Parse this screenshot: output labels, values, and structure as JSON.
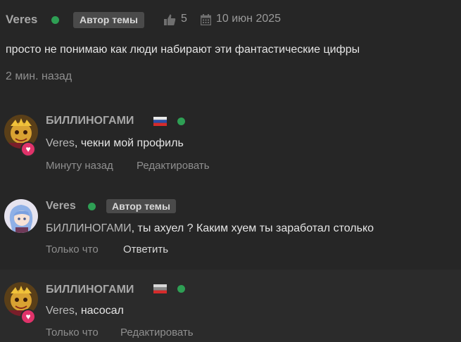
{
  "post": {
    "author": "Veres",
    "author_badge": "Автор темы",
    "likes": "5",
    "date": "10 июн 2025",
    "text": "просто не понимаю как люди набирают эти фантастические цифры",
    "time": "2 мин. назад"
  },
  "replies": [
    {
      "author": "БИЛЛИНОГАМИ",
      "mention": "Veres",
      "text": ", чекни мой профиль",
      "time": "Минуту назад",
      "action": "Редактировать"
    },
    {
      "author": "Veres",
      "badge": "Автор темы",
      "mention": "БИЛЛИНОГАМИ",
      "text": ", ты ахуел ? Каким хуем ты заработал столько",
      "time": "Только что",
      "action": "Ответить"
    },
    {
      "author": "БИЛЛИНОГАМИ",
      "mention": "Veres",
      "text": ", насосал",
      "time": "Только что",
      "action": "Редактировать"
    }
  ],
  "colors": {
    "background": "#262626",
    "online": "#2e9f54",
    "heart": "#e0336a",
    "badge_bg": "#4a4a4a"
  },
  "icons": [
    "thumbs-up-icon",
    "calendar-icon",
    "heart-icon",
    "flag-icon"
  ]
}
